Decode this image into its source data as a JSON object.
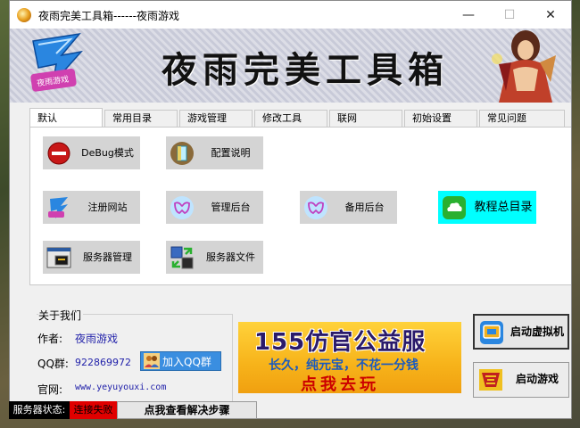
{
  "window": {
    "title": "夜雨完美工具箱------夜雨游戏",
    "minimize_glyph": "—",
    "maximize_glyph": "☐",
    "close_glyph": "✕"
  },
  "banner": {
    "title": "夜雨完美工具箱",
    "logo_text": "夜雨游戏"
  },
  "tabs": [
    "默认",
    "常用目录",
    "游戏管理",
    "修改工具",
    "联网",
    "初始设置",
    "常见问题"
  ],
  "tools": {
    "debug": "DeBug模式",
    "config": "配置说明",
    "register": "注册网站",
    "admin": "管理后台",
    "backup_admin": "备用后台",
    "tutorial": "教程总目录",
    "server_manage": "服务器管理",
    "server_files": "服务器文件"
  },
  "about": {
    "title": "关于我们",
    "author_label": "作者:",
    "author_value": "夜雨游戏",
    "qq_label": "QQ群:",
    "qq_value": "922869972",
    "qq_button": "加入QQ群",
    "site_label": "官网:",
    "site_value": "www.yeyuyouxi.com"
  },
  "ad": {
    "title": "155仿官公益服",
    "subtitle": "长久，纯元宝，不花一分钱",
    "cta": "点我去玩"
  },
  "buttons": {
    "start_vm": "启动虚拟机",
    "start_game": "启动游戏"
  },
  "status": {
    "label": "服务器状态:",
    "value": "连接失败",
    "solve_button": "点我查看解决步骤",
    "value_color": "#e00000"
  }
}
